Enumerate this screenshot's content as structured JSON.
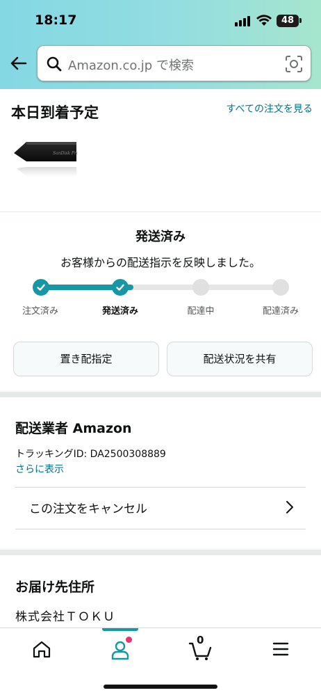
{
  "status_bar": {
    "time": "18:17",
    "battery": "48"
  },
  "search": {
    "placeholder": "Amazon.co.jp で検索"
  },
  "delivery": {
    "title": "本日到着予定",
    "all_orders_link": "すべての注文を見る",
    "status": "発送済み",
    "message": "お客様からの配送指示を反映しました。",
    "progress": 0.333,
    "steps": [
      {
        "label": "注文済み",
        "done": true
      },
      {
        "label": "発送済み",
        "done": true,
        "current": true
      },
      {
        "label": "配達中",
        "done": false
      },
      {
        "label": "配達済み",
        "done": false
      }
    ],
    "buttons": {
      "drop_off": "置き配指定",
      "share": "配送状況を共有"
    }
  },
  "carrier": {
    "title": "配送業者 Amazon",
    "tracking": "トラッキングID: DA2500308889",
    "show_more": "さらに表示",
    "cancel": "この注文をキャンセル"
  },
  "address": {
    "title": "お届け先住所",
    "name": "株式会社ＴＯＫＵ"
  },
  "bottom_nav": {
    "items": [
      "home-icon",
      "account-icon",
      "cart-icon",
      "menu-icon"
    ],
    "active": "account-icon",
    "cart_count": "0"
  },
  "colors": {
    "accent": "#1797a6",
    "link": "#007185",
    "notification": "#e8336f"
  }
}
